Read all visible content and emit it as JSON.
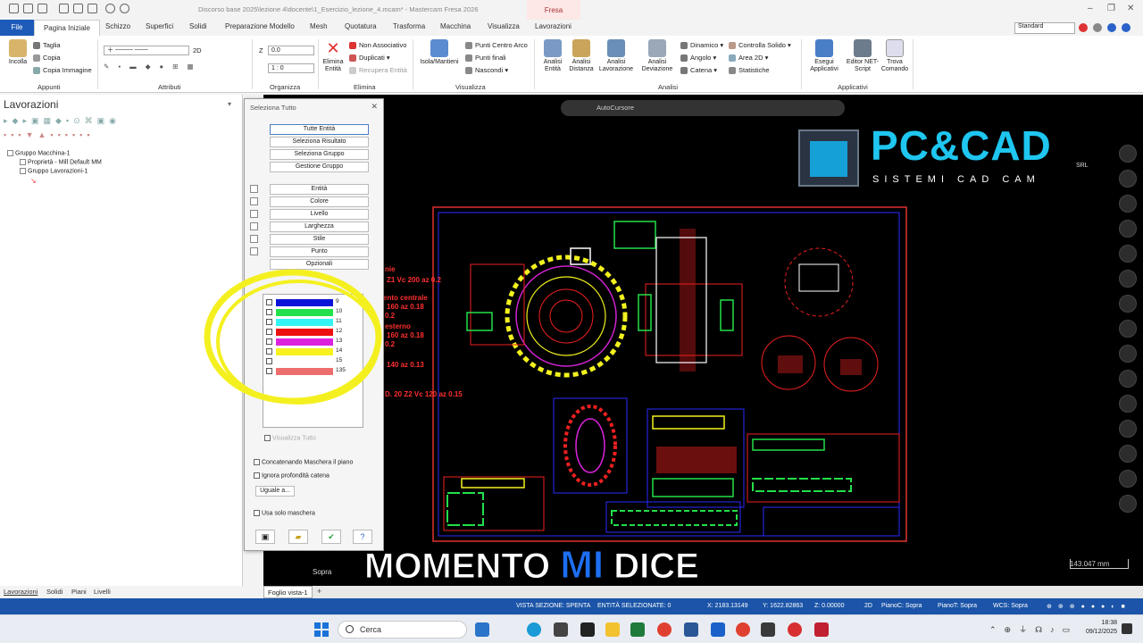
{
  "window": {
    "title": "Discorso base 2025\\lezione 4\\docente\\1_Esercizio_lezione_4.mcam* - Mastercam Fresa 2026",
    "context_tab": "Fresa"
  },
  "tabs": [
    "File",
    "Pagina Iniziale",
    "Schizzo",
    "Superfici",
    "Solidi",
    "Preparazione Modello",
    "Mesh",
    "Quotatura",
    "Trasforma",
    "Macchina",
    "Visualizza",
    "Lavorazioni"
  ],
  "standard_select": "Standard",
  "ribbon": {
    "appunti": {
      "label": "Appunti",
      "incolla": "Incolla",
      "taglia": "Taglia",
      "copia": "Copia",
      "copia_immagine": "Copia Immagine"
    },
    "attributi": {
      "label": "Attributi",
      "mode": "2D"
    },
    "organizza": {
      "label": "Organizza",
      "z_label": "Z",
      "z_value": "0.0",
      "scale_value": "1 : 0"
    },
    "elimina": {
      "label": "Elimina",
      "elimina_entita": "Elimina Entità",
      "non_associativo": "Non Associativo",
      "duplicati": "Duplicati",
      "recupera": "Recupera Entità"
    },
    "visualizza": {
      "label": "Visualizza",
      "isola": "Isola/Mantieni",
      "punti_centro": "Punti Centro Arco",
      "punti_finali": "Punti finali",
      "nascondi": "Nascondi"
    },
    "analisi": {
      "label": "Analisi",
      "entita": "Analisi Entità",
      "distanza": "Analisi Distanza",
      "lavorazione": "Analisi Lavorazione",
      "deviazione": "Analisi Deviazione",
      "dinamico": "Dinamico",
      "angolo": "Angolo",
      "catena": "Catena",
      "controlla": "Controlla Solido",
      "area": "Area 2D",
      "statistiche": "Statistiche"
    },
    "applicativi": {
      "label": "Applicativi",
      "esegui": "Esegui Applicativi",
      "editor": "Editor NET-Script",
      "trova": "Trova Comando"
    }
  },
  "left_panel": {
    "title": "Lavorazioni",
    "tree": [
      "Gruppo Macchina-1",
      "Proprietà - Mill Default MM",
      "Gruppo Lavorazioni-1"
    ],
    "bottom_tabs": [
      "Lavorazioni",
      "Solidi",
      "Piani",
      "Livelli"
    ]
  },
  "dialog": {
    "title": "Seleziona Tutto",
    "top_buttons": [
      "Tutte Entità",
      "Seleziona Risultato",
      "Seleziona Gruppo",
      "Gestione Gruppo"
    ],
    "filter_buttons": [
      "Entità",
      "Colore",
      "Livello",
      "Larghezza",
      "Stile",
      "Punto",
      "Opzionali"
    ],
    "colors": [
      {
        "num": "9",
        "hex": "#0a14d8"
      },
      {
        "num": "10",
        "hex": "#22e04a"
      },
      {
        "num": "11",
        "hex": "#33f4f4"
      },
      {
        "num": "12",
        "hex": "#ee1010"
      },
      {
        "num": "13",
        "hex": "#dd22dd"
      },
      {
        "num": "14",
        "hex": "#f7f21e"
      },
      {
        "num": "15",
        "hex": "#ffffff"
      },
      {
        "num": "135",
        "hex": "#ee6e6e"
      }
    ],
    "visualizza_tutto": "Visualizza Tutto",
    "opt_concatenando": "Concatenando Maschera il piano",
    "opt_ignora": "Ignora profondità catena",
    "uguale": "Uguale a...",
    "opt_solo_maschera": "Usa solo maschera"
  },
  "viewport": {
    "floatbar_label": "AutoCursore",
    "logo": {
      "main": "PC&CAD",
      "srl": "SRL",
      "sub": "SISTEMI CAD CAM"
    },
    "caption": {
      "part1": "MOMENTO",
      "highlight": "MI",
      "part2": "DICE"
    },
    "scale": "143.047 mm",
    "view_name": "Sopra",
    "cad_texts": [
      "nie",
      "Z1 Vc 200 az 0.2",
      "ento centrale",
      "160 az 0.18",
      "0.2",
      "esterno",
      "160 az 0.18",
      "0.2",
      "140 az 0.13",
      "D. 20 Z2 Vc 120 az 0.15"
    ]
  },
  "sheet_tab": "Foglio vista-1",
  "status": {
    "vista_sezione": "VISTA SEZIONE: SPENTA",
    "entita_selezionate": "ENTITÀ SELEZIONATE: 0",
    "x": "X: 2183.13149",
    "y": "Y: 1622.82863",
    "z": "Z: 0.00000",
    "mode": "2D",
    "pianoc": "PianoC: Sopra",
    "pianot": "PianoT: Sopra",
    "wcs": "WCS: Sopra"
  },
  "taskbar": {
    "search": "Cerca",
    "time": "18:38",
    "date": "09/12/2025"
  }
}
